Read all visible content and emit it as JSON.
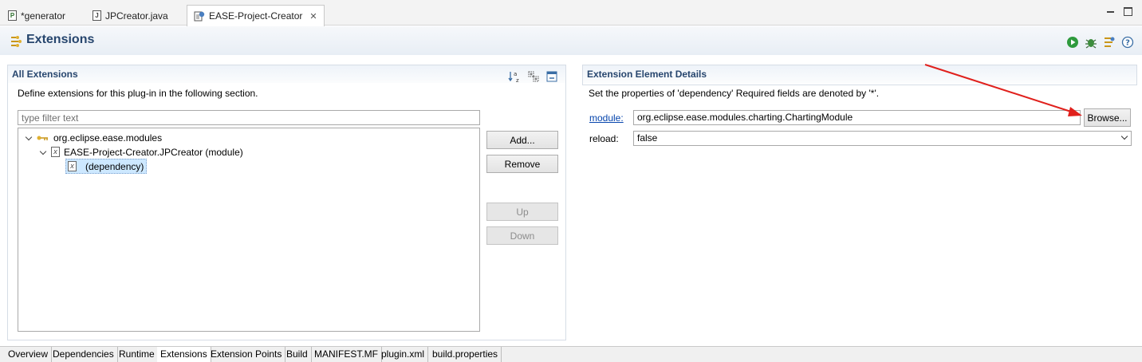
{
  "editor_tabs": [
    {
      "label": "*generator",
      "icon": "plugin-file-icon"
    },
    {
      "label": "JPCreator.java",
      "icon": "java-file-icon"
    },
    {
      "label": "EASE-Project-Creator",
      "icon": "manifest-editor-icon",
      "active": true
    }
  ],
  "header": {
    "title": "Extensions"
  },
  "all_extensions": {
    "title": "All Extensions",
    "description": "Define extensions for this plug-in in the following section.",
    "filter_placeholder": "type filter text",
    "tree": [
      {
        "label": "org.eclipse.ease.modules",
        "level": 0
      },
      {
        "label": "EASE-Project-Creator.JPCreator (module)",
        "level": 1
      },
      {
        "label": "(dependency)",
        "level": 2,
        "selected": true
      }
    ],
    "buttons": {
      "add": "Add...",
      "remove": "Remove",
      "up": "Up",
      "down": "Down"
    }
  },
  "details": {
    "title": "Extension Element Details",
    "description": "Set the properties of 'dependency' Required fields are denoted by '*'.",
    "module_label": "module:",
    "module_value": "org.eclipse.ease.modules.charting.ChartingModule",
    "browse_label": "Browse...",
    "reload_label": "reload:",
    "reload_value": "false"
  },
  "page_tabs": [
    "Overview",
    "Dependencies",
    "Runtime",
    "Extensions",
    "Extension Points",
    "Build",
    "MANIFEST.MF",
    "plugin.xml",
    "build.properties"
  ],
  "active_page_tab": "Extensions",
  "colors": {
    "section_title": "#27466e",
    "link": "#0645ad",
    "annotation_arrow": "#e0201c"
  }
}
